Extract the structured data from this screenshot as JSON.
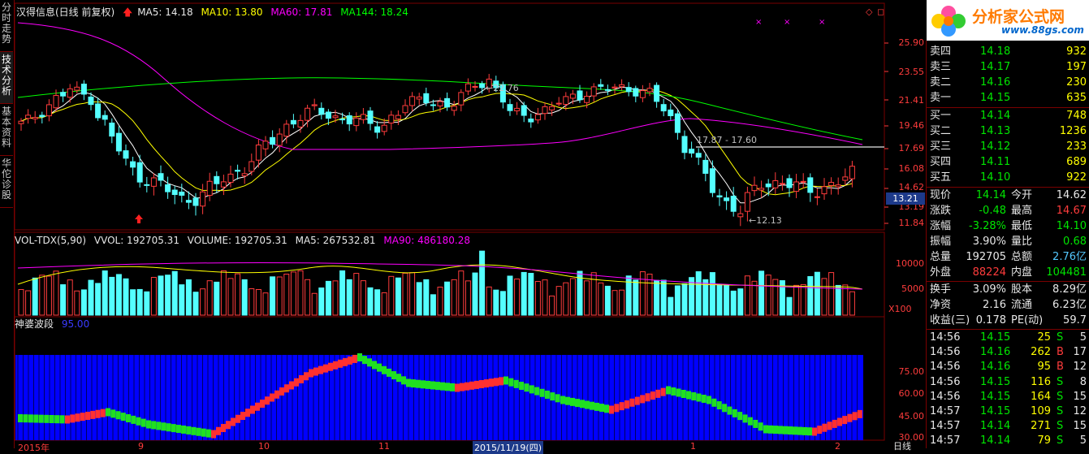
{
  "left_tabs": [
    "分时走势",
    "技术分析",
    "基本资料",
    "华佗诊股"
  ],
  "main_header": {
    "title": "汉得信息(日线 前复权)",
    "ma5": "MA5: 14.18",
    "ma10": "MA10: 13.80",
    "ma60": "MA60: 17.81",
    "ma144": "MA144: 18.24"
  },
  "price_axis": [
    "25.90",
    "23.55",
    "21.41",
    "19.46",
    "17.69",
    "16.08",
    "14.62",
    "13.19",
    "11.84"
  ],
  "current_price_tag": "13.21",
  "price_annotations": {
    "high": "22.76",
    "low": "12.13",
    "mid_level": "17.87 - 17.60"
  },
  "vol_header": {
    "name": "VOL-TDX(5,90)",
    "vvol": "VVOL: 192705.31",
    "volume": "VOLUME: 192705.31",
    "ma5": "MA5: 267532.81",
    "ma90": "MA90: 486180.28"
  },
  "vol_axis": [
    "10000",
    "5000"
  ],
  "vol_unit": "X100",
  "wave_header": {
    "name": "神婆波段",
    "value": "95.00"
  },
  "wave_axis": [
    "75.00",
    "60.00",
    "45.00",
    "30.00"
  ],
  "date_axis": [
    "2015年",
    "9",
    "10",
    "11",
    "2015/11/19(四)",
    "1",
    "2"
  ],
  "bottom_right_label": "日线",
  "logo": {
    "brand": "分析家公式网",
    "url": "www.88gs.com"
  },
  "order_book": {
    "asks": [
      {
        "label": "卖四",
        "price": "14.18",
        "vol": "932"
      },
      {
        "label": "卖三",
        "price": "14.17",
        "vol": "197"
      },
      {
        "label": "卖二",
        "price": "14.16",
        "vol": "230"
      },
      {
        "label": "卖一",
        "price": "14.15",
        "vol": "635"
      }
    ],
    "bids": [
      {
        "label": "买一",
        "price": "14.14",
        "vol": "748"
      },
      {
        "label": "买二",
        "price": "14.13",
        "vol": "1236"
      },
      {
        "label": "买三",
        "price": "14.12",
        "vol": "233"
      },
      {
        "label": "买四",
        "price": "14.11",
        "vol": "689"
      },
      {
        "label": "买五",
        "price": "14.10",
        "vol": "922"
      }
    ]
  },
  "quote_stats": [
    {
      "l1": "现价",
      "v1": "14.14",
      "c1": "green",
      "l2": "今开",
      "v2": "14.62",
      "c2": "white"
    },
    {
      "l1": "涨跌",
      "v1": "-0.48",
      "c1": "green",
      "l2": "最高",
      "v2": "14.67",
      "c2": "red"
    },
    {
      "l1": "涨幅",
      "v1": "-3.28%",
      "c1": "green",
      "l2": "最低",
      "v2": "14.10",
      "c2": "green"
    },
    {
      "l1": "振幅",
      "v1": "3.90%",
      "c1": "white",
      "l2": "量比",
      "v2": "0.68",
      "c2": "green"
    },
    {
      "l1": "总量",
      "v1": "192705",
      "c1": "white",
      "l2": "总额",
      "v2": "2.76亿",
      "c2": "blue"
    },
    {
      "l1": "外盘",
      "v1": "88224",
      "c1": "red",
      "l2": "内盘",
      "v2": "104481",
      "c2": "green"
    }
  ],
  "fundamentals": [
    {
      "l1": "换手",
      "v1": "3.09%",
      "l2": "股本",
      "v2": "8.29亿"
    },
    {
      "l1": "净资",
      "v1": "2.16",
      "l2": "流通",
      "v2": "6.23亿"
    },
    {
      "l1": "收益(三)",
      "v1": "0.178",
      "l2": "PE(动)",
      "v2": "59.7"
    }
  ],
  "trades": [
    {
      "time": "14:56",
      "price": "14.15",
      "vol": "25",
      "side": "S",
      "n": "5"
    },
    {
      "time": "14:56",
      "price": "14.16",
      "vol": "262",
      "side": "B",
      "n": "17"
    },
    {
      "time": "14:56",
      "price": "14.16",
      "vol": "95",
      "side": "B",
      "n": "12"
    },
    {
      "time": "14:56",
      "price": "14.15",
      "vol": "116",
      "side": "S",
      "n": "8"
    },
    {
      "time": "14:56",
      "price": "14.15",
      "vol": "164",
      "side": "S",
      "n": "15"
    },
    {
      "time": "14:57",
      "price": "14.15",
      "vol": "109",
      "side": "S",
      "n": "12"
    },
    {
      "time": "14:57",
      "price": "14.14",
      "vol": "271",
      "side": "S",
      "n": "15"
    },
    {
      "time": "14:57",
      "price": "14.14",
      "vol": "79",
      "side": "S",
      "n": "5"
    }
  ],
  "colors": {
    "up": "#ff3c3c",
    "down": "#54ffff",
    "ma5": "#ffffff",
    "ma10": "#ffff00",
    "ma60": "#ff00ff",
    "ma144": "#00ff00",
    "wave_bg": "#0000ff"
  }
}
